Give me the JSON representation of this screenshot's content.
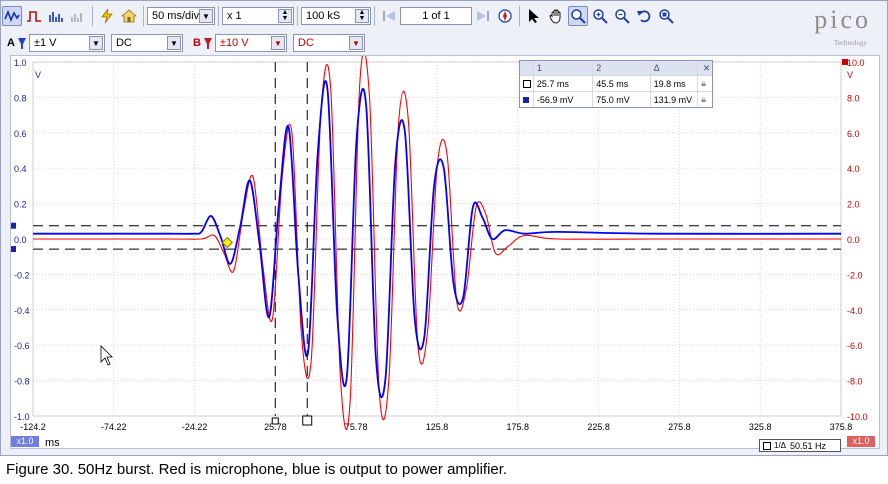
{
  "toolbar1": {
    "timebase": "50 ms/div",
    "zoom": "x 1",
    "samples": "100 kS",
    "page": "1 of 1"
  },
  "toolbar2": {
    "chA_label": "A",
    "chA_range": "±1 V",
    "chA_coupling": "DC",
    "chB_label": "B",
    "chB_range": "±10 V",
    "chB_coupling": "DC"
  },
  "logo": {
    "text": "pico",
    "sub": "Technology"
  },
  "rulers": {
    "headers": [
      "1",
      "2",
      "Δ"
    ],
    "time": [
      "25.7 ms",
      "45.5 ms",
      "19.8 ms"
    ],
    "voltage": [
      "-56.9 mV",
      "75.0 mV",
      "131.9 mV"
    ]
  },
  "freq_readout": "50.51 Hz",
  "caption": "Figure 30. 50Hz burst. Red is microphone, blue is output to power amplifier.",
  "colors": {
    "chA": "#0000ff",
    "chB": "#ff0000"
  },
  "chart_data": {
    "type": "line",
    "xlabel": "ms",
    "x_ticks": [
      "-124.2",
      "-74.22",
      "-24.22",
      "25.78",
      "75.78",
      "125.8",
      "175.8",
      "225.8",
      "275.8",
      "325.8",
      "375.8"
    ],
    "xlim": [
      -124.2,
      375.8
    ],
    "left_axis": {
      "unit": "V",
      "ticks": [
        "1.0",
        "0.8",
        "0.6",
        "0.4",
        "0.2",
        "0.0",
        "-0.2",
        "-0.4",
        "-0.6",
        "-0.8",
        "-1.0"
      ],
      "ylim": [
        -1.0,
        1.0
      ],
      "zoom_label": "x1.0"
    },
    "right_axis": {
      "unit": "V",
      "ticks": [
        "10.0",
        "8.0",
        "6.0",
        "4.0",
        "2.0",
        "0.0",
        "-2.0",
        "-4.0",
        "-6.0",
        "-8.0",
        "-10.0"
      ],
      "ylim": [
        -10.0,
        10.0
      ],
      "zoom_label": "x1.0"
    },
    "series": [
      {
        "name": "A",
        "color": "#0000ff",
        "axis": "left",
        "x": [
          -124.2,
          -55,
          -40,
          -25,
          -20,
          -14,
          -8,
          -2,
          4,
          10,
          16,
          22,
          28,
          34,
          40,
          46,
          52,
          58,
          64,
          70,
          76,
          82,
          88,
          94,
          100,
          106,
          112,
          118,
          124,
          130,
          136,
          142,
          148,
          154,
          160,
          168,
          180,
          200,
          260,
          375.8
        ],
        "y": [
          0.03,
          0.03,
          0.03,
          0.03,
          0.04,
          0.13,
          0.01,
          -0.14,
          0.07,
          0.33,
          -0.03,
          -0.44,
          0.2,
          0.63,
          -0.2,
          -0.64,
          0.48,
          0.85,
          -0.42,
          -0.78,
          0.56,
          0.75,
          -0.67,
          -0.78,
          0.43,
          0.6,
          -0.45,
          -0.55,
          0.3,
          0.4,
          -0.25,
          -0.33,
          0.18,
          0.12,
          0.0,
          0.05,
          0.03,
          0.04,
          0.03,
          0.03
        ]
      },
      {
        "name": "B",
        "color": "#ff0000",
        "axis": "right",
        "x": [
          -124.2,
          -40,
          -20,
          -12,
          -6,
          0,
          6,
          12,
          18,
          24,
          30,
          36,
          42,
          48,
          54,
          60,
          66,
          72,
          78,
          84,
          90,
          96,
          102,
          108,
          114,
          120,
          126,
          132,
          138,
          144,
          150,
          156,
          162,
          170,
          180,
          200,
          260,
          375.8
        ],
        "y": [
          0.0,
          0.0,
          0.0,
          0.2,
          -0.8,
          -1.8,
          1.5,
          3.5,
          -1.5,
          -4.5,
          3.5,
          6.0,
          -5.5,
          -6.8,
          7.2,
          8.5,
          -7.8,
          -9.2,
          8.8,
          8.0,
          -8.5,
          -8.0,
          6.5,
          6.8,
          -6.0,
          -5.2,
          4.2,
          4.8,
          -3.5,
          -2.8,
          1.8,
          1.4,
          -0.8,
          -0.4,
          0.2,
          0.0,
          0.0,
          0.0
        ]
      }
    ],
    "rulers": {
      "time": [
        25.7,
        45.5
      ],
      "voltage": [
        -0.0569,
        0.075
      ]
    },
    "trigger": {
      "x": -4.0,
      "y": -0.02
    }
  }
}
